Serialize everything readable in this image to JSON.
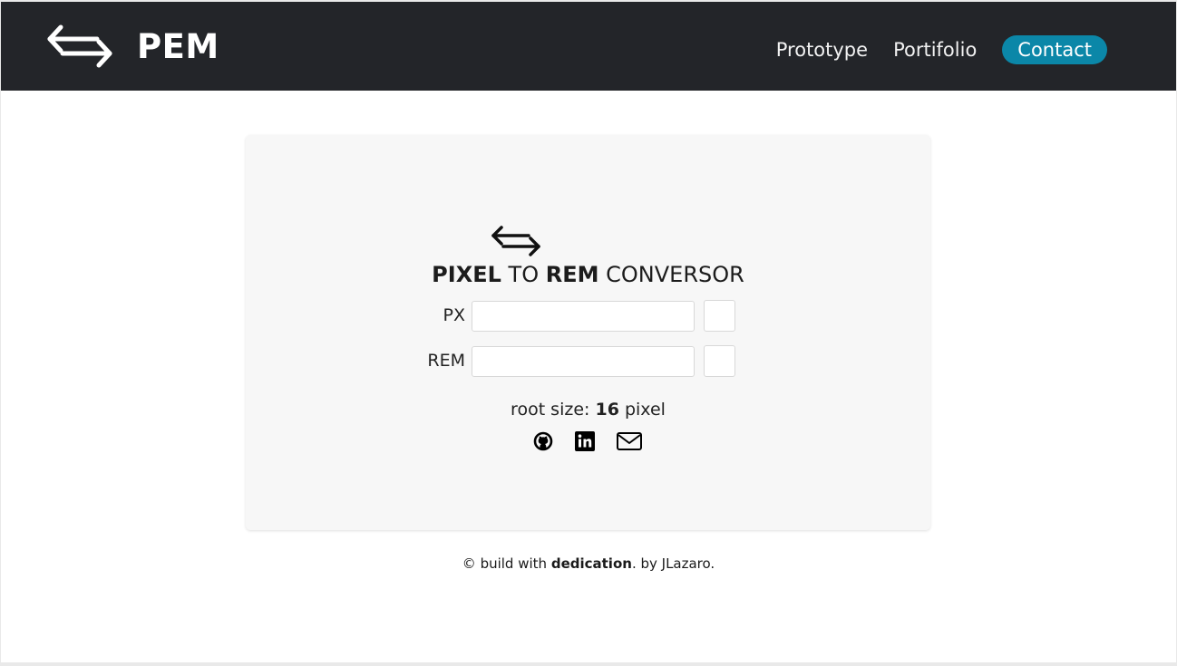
{
  "navbar": {
    "brand_name": "PEM",
    "brand_icon": "swap-arrows-icon",
    "links": [
      "Prototype",
      "Portifolio"
    ],
    "contact_label": "Contact",
    "contact_color": "#0b87a8",
    "background": "#232529"
  },
  "converter": {
    "logo_icon": "swap-arrows-icon",
    "title_part1": "PIXEL",
    "title_part2": "TO",
    "title_part3": "REM",
    "title_part4": "CONVERSOR",
    "px_label": "PX",
    "px_value": "",
    "rem_label": "REM",
    "rem_value": "",
    "root_size_prefix": "root size:",
    "root_size_value": "16",
    "root_size_suffix": "pixel",
    "social_icons": [
      "github-icon",
      "linkedin-icon",
      "mail-icon"
    ]
  },
  "footer": {
    "prefix": "© build with",
    "emphasis": "dedication",
    "suffix": ". by JLazaro."
  }
}
